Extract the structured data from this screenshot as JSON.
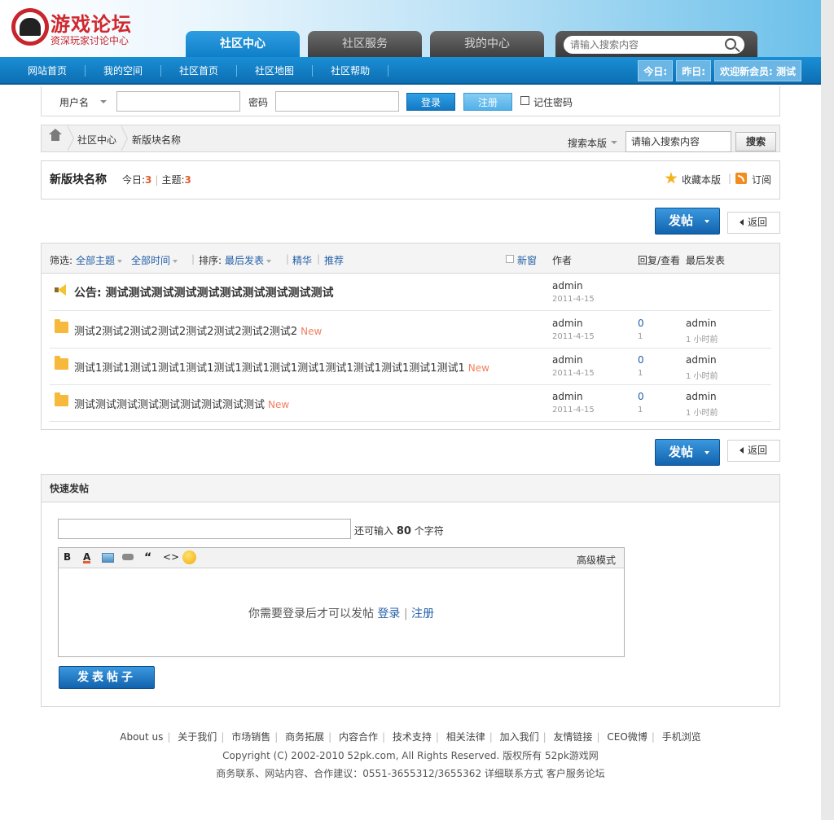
{
  "header": {
    "logo_title": "游戏论坛",
    "logo_subtitle": "资深玩家讨论中心",
    "tabs": [
      {
        "label": "社区中心",
        "active": true
      },
      {
        "label": "社区服务",
        "active": false
      },
      {
        "label": "我的中心",
        "active": false
      }
    ],
    "search_placeholder": "请输入搜索内容"
  },
  "nav": {
    "links": [
      "网站首页",
      "我的空间",
      "社区首页",
      "社区地图",
      "社区帮助"
    ],
    "today_label": "今日:",
    "yesterday_label": "昨日:",
    "welcome_label": "欢迎新会员: 测试"
  },
  "login": {
    "username_label": "用户名",
    "password_label": "密码",
    "login_button": "登录",
    "register_button": "注册",
    "remember_label": "记住密码"
  },
  "breadcrumb": {
    "items": [
      "社区中心",
      "新版块名称"
    ],
    "search_label": "搜索本版",
    "search_placeholder": "请输入搜索内容",
    "search_button": "搜索"
  },
  "forum": {
    "name": "新版块名称",
    "today_label": "今日:",
    "today_count": "3",
    "topics_label": "主题:",
    "topics_count": "3",
    "favorite_label": "收藏本版",
    "subscribe_label": "订阅"
  },
  "actions": {
    "post_button": "发帖",
    "back_button": "返回"
  },
  "thread_list": {
    "filter_label": "筛选:",
    "filter_all_topics": "全部主题",
    "filter_all_time": "全部时间",
    "sort_label": "排序:",
    "sort_value": "最后发表",
    "digest": "精华",
    "recommend": "推荐",
    "new_window": "新窗",
    "col_author": "作者",
    "col_reply_view": "回复/查看",
    "col_last_post": "最后发表",
    "notice": {
      "title": "公告: 测试测试测试测试测试测试测试测试测试测试",
      "author": "admin",
      "date": "2011-4-15"
    },
    "rows": [
      {
        "title": "测试2测试2测试2测试2测试2测试2测试2测试2",
        "new": "New",
        "author": "admin",
        "date": "2011-4-15",
        "replies": "0",
        "views": "1",
        "last_author": "admin",
        "last_time": "1 小时前"
      },
      {
        "title": "测试1测试1测试1测试1测试1测试1测试1测试1测试1测试1测试1测试1测试1测试1",
        "new": "New",
        "author": "admin",
        "date": "2011-4-15",
        "replies": "0",
        "views": "1",
        "last_author": "admin",
        "last_time": "1 小时前"
      },
      {
        "title": "测试测试测试测试测试测试测试测试测试",
        "new": "New",
        "author": "admin",
        "date": "2011-4-15",
        "replies": "0",
        "views": "1",
        "last_author": "admin",
        "last_time": "1 小时前"
      }
    ]
  },
  "quick_post": {
    "heading": "快速发帖",
    "hint_prefix": "还可输入",
    "hint_count": "80",
    "hint_suffix": "个字符",
    "tool_bold": "B",
    "tool_color": "A",
    "tool_quote": "“",
    "tool_code": "<>",
    "advanced_mode": "高级模式",
    "login_required": "你需要登录后才可以发帖",
    "login_link": "登录",
    "register_link": "注册",
    "submit_button": "发表帖子"
  },
  "footer": {
    "links": [
      "About us",
      "关于我们",
      "市场销售",
      "商务拓展",
      "内容合作",
      "技术支持",
      "相关法律",
      "加入我们",
      "友情链接",
      "CEO微博",
      "手机浏览"
    ],
    "copyright": "Copyright (C) 2002-2010 52pk.com, All Rights Reserved. 版权所有 52pk游戏网",
    "contact": "商务联系、网站内容、合作建议：0551-3655312/3655362 详细联系方式 客户服务论坛"
  },
  "colors": {
    "brand_red": "#d0282e",
    "nav_blue": "#0d6fb3",
    "link_blue": "#2460a8",
    "new_orange": "#f08060",
    "count_orange": "#e0602e"
  }
}
